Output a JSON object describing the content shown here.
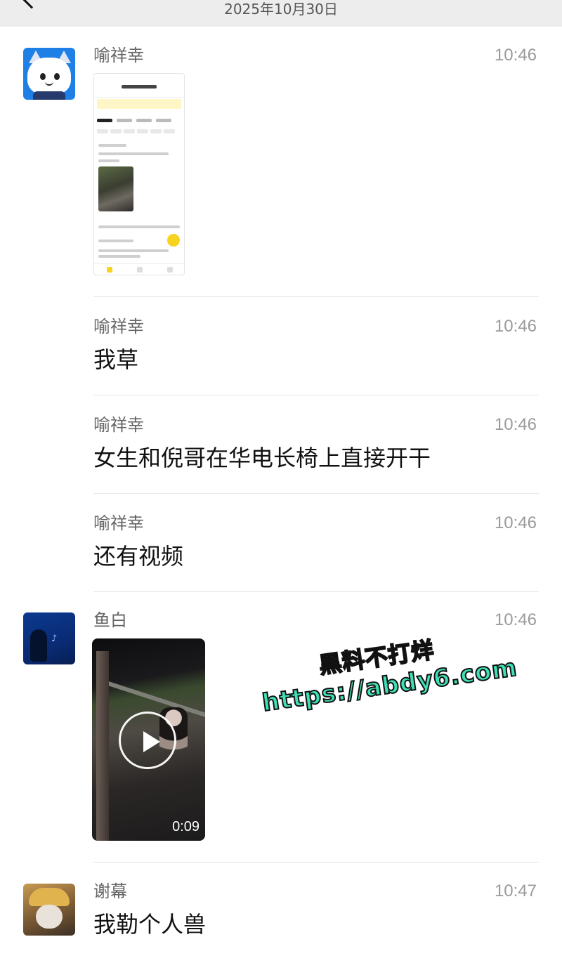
{
  "header": {
    "date": "2025年10月30日"
  },
  "messages": [
    {
      "sender": "喻祥幸",
      "time": "10:46",
      "type": "image",
      "avatar": "cartoon-cat-avatar"
    },
    {
      "sender": "喻祥幸",
      "time": "10:46",
      "type": "text",
      "text": "我草"
    },
    {
      "sender": "喻祥幸",
      "time": "10:46",
      "type": "text",
      "text": "女生和倪哥在华电长椅上直接开干"
    },
    {
      "sender": "喻祥幸",
      "time": "10:46",
      "type": "text",
      "text": "还有视频"
    },
    {
      "sender": "鱼白",
      "time": "10:46",
      "type": "video",
      "duration": "0:09",
      "avatar": "night-blue-avatar"
    },
    {
      "sender": "谢幕",
      "time": "10:47",
      "type": "text",
      "text": "我勒个人兽",
      "avatar": "photo-avatar"
    }
  ],
  "watermark": {
    "line1": "黑料不打烊",
    "line2": "https://abdy6.com"
  },
  "colors": {
    "topbar": "#ededed",
    "watermark": "#3fe0b6",
    "avatar_blue": "#1e7fe6"
  }
}
